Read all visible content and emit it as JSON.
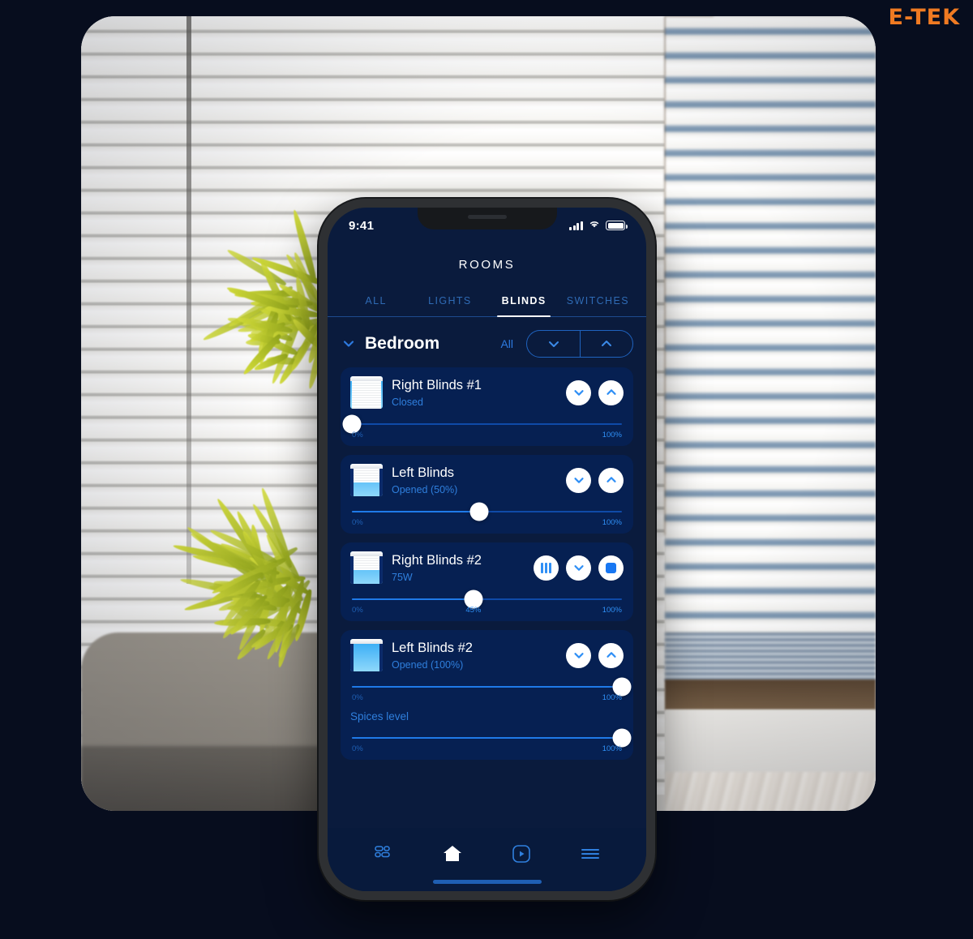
{
  "brand": {
    "logo_text": "E-TEK",
    "accent_color": "#f07a22"
  },
  "phone": {
    "status_bar": {
      "time": "9:41",
      "icons": [
        "signal-bars-icon",
        "wifi-icon",
        "battery-icon"
      ]
    },
    "header": {
      "title": "ROOMS"
    },
    "tabs": [
      {
        "label": "ALL",
        "active": false
      },
      {
        "label": "LIGHTS",
        "active": false
      },
      {
        "label": "BLINDS",
        "active": true
      },
      {
        "label": "SWITCHES",
        "active": false
      }
    ],
    "room": {
      "name": "Bedroom",
      "all_label": "All",
      "collapse_icon": "chevron-down-icon",
      "group_controls": [
        "chevron-down-icon",
        "chevron-up-icon"
      ]
    },
    "devices": [
      {
        "name": "Right Blinds #1",
        "status": "Closed",
        "icon": "blind-closed-icon",
        "open_percent": 0,
        "buttons": [
          "chevron-down-icon",
          "chevron-up-icon"
        ],
        "slider": {
          "value": 0,
          "min_label": "0%",
          "max_label": "100%",
          "mid_label": ""
        }
      },
      {
        "name": "Left Blinds",
        "status": "Opened (50%)",
        "icon": "blind-half-icon",
        "open_percent": 50,
        "buttons": [
          "chevron-down-icon",
          "chevron-up-icon"
        ],
        "slider": {
          "value": 50,
          "min_label": "0%",
          "max_label": "100%",
          "mid_label": ""
        }
      },
      {
        "name": "Right Blinds #2",
        "status": "75W",
        "icon": "blind-half-icon",
        "open_percent": 45,
        "buttons": [
          "pause-icon",
          "chevron-down-icon",
          "stop-icon"
        ],
        "slider": {
          "value": 45,
          "min_label": "0%",
          "max_label": "100%",
          "mid_label": "45%"
        }
      },
      {
        "name": "Left Blinds #2",
        "status": "Opened (100%)",
        "icon": "blind-open-icon",
        "open_percent": 100,
        "buttons": [
          "chevron-down-icon",
          "chevron-up-icon"
        ],
        "slider": {
          "value": 100,
          "min_label": "0%",
          "max_label": "100%",
          "mid_label": ""
        },
        "extra_slider": {
          "label": "Spices level",
          "value": 100,
          "min_label": "0%",
          "max_label": "100%"
        }
      }
    ],
    "nav": [
      {
        "icon": "dashboard-icon",
        "active": false
      },
      {
        "icon": "home-icon",
        "active": true
      },
      {
        "icon": "media-play-icon",
        "active": false
      },
      {
        "icon": "menu-icon",
        "active": false
      }
    ]
  }
}
